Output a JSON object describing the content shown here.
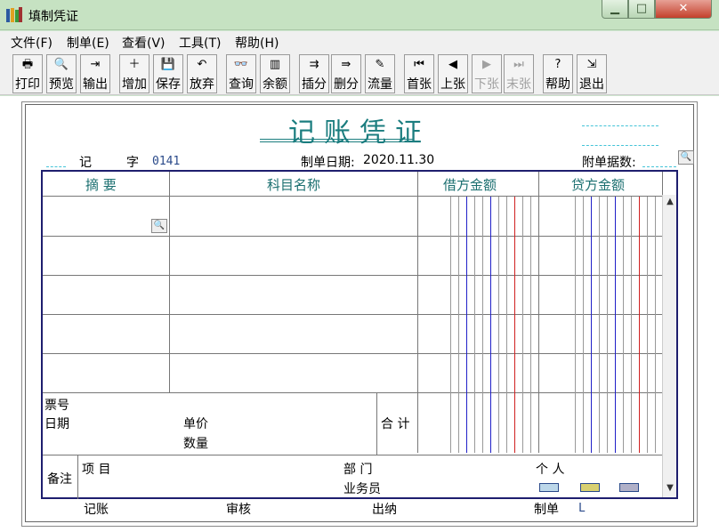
{
  "window": {
    "title": "填制凭证",
    "controls": [
      "minimize",
      "maximize",
      "close"
    ]
  },
  "menu": [
    "文件(F)",
    "制单(E)",
    "查看(V)",
    "工具(T)",
    "帮助(H)"
  ],
  "toolbar": [
    {
      "label": "打印",
      "icon": "printer-icon",
      "glyph": "🖶",
      "enabled": true
    },
    {
      "label": "预览",
      "icon": "preview-icon",
      "glyph": "🔍",
      "enabled": true
    },
    {
      "label": "输出",
      "icon": "export-icon",
      "glyph": "⇥",
      "enabled": true
    },
    {
      "label": "增加",
      "icon": "add-icon",
      "glyph": "＋",
      "enabled": true
    },
    {
      "label": "保存",
      "icon": "save-icon",
      "glyph": "💾",
      "enabled": true
    },
    {
      "label": "放弃",
      "icon": "undo-icon",
      "glyph": "↶",
      "enabled": true
    },
    {
      "label": "查询",
      "icon": "binoculars-icon",
      "glyph": "👓",
      "enabled": true
    },
    {
      "label": "余额",
      "icon": "bar-chart-icon",
      "glyph": "▥",
      "enabled": true
    },
    {
      "label": "插分",
      "icon": "insert-row-icon",
      "glyph": "⇉",
      "enabled": true
    },
    {
      "label": "删分",
      "icon": "delete-row-icon",
      "glyph": "⇛",
      "enabled": true
    },
    {
      "label": "流量",
      "icon": "edit-flow-icon",
      "glyph": "✎",
      "enabled": true
    },
    {
      "label": "首张",
      "icon": "first-record-icon",
      "glyph": "⏮",
      "enabled": true
    },
    {
      "label": "上张",
      "icon": "previous-record-icon",
      "glyph": "◀",
      "enabled": true
    },
    {
      "label": "下张",
      "icon": "next-record-icon",
      "glyph": "▶",
      "enabled": false
    },
    {
      "label": "末张",
      "icon": "last-record-icon",
      "glyph": "⏭",
      "enabled": false
    },
    {
      "label": "帮助",
      "icon": "help-icon",
      "glyph": "?",
      "enabled": true
    },
    {
      "label": "退出",
      "icon": "exit-icon",
      "glyph": "⇲",
      "enabled": true
    }
  ],
  "voucher": {
    "title": "记账凭证",
    "type_label": "记",
    "number_label": "字",
    "number": "0141",
    "date_label": "制单日期:",
    "date": "2020.11.30",
    "attachments_label": "附单据数:",
    "attachments": ""
  },
  "table": {
    "columns": [
      "摘 要",
      "科目名称",
      "借方金额",
      "贷方金额"
    ],
    "rows": [
      {
        "summary": "",
        "account": "",
        "debit": "",
        "credit": ""
      },
      {
        "summary": "",
        "account": "",
        "debit": "",
        "credit": ""
      },
      {
        "summary": "",
        "account": "",
        "debit": "",
        "credit": ""
      },
      {
        "summary": "",
        "account": "",
        "debit": "",
        "credit": ""
      },
      {
        "summary": "",
        "account": "",
        "debit": "",
        "credit": ""
      }
    ]
  },
  "footer": {
    "ticket_no_label": "票号",
    "date_label": "日期",
    "unit_price_label": "单价",
    "quantity_label": "数量",
    "total_label": "合 计",
    "remarks_label": "备注",
    "project_label": "项 目",
    "department_label": "部 门",
    "person_label": "个 人",
    "salesperson_label": "业务员"
  },
  "signatures": {
    "bookkeeper_label": "记账",
    "reviewer_label": "审核",
    "cashier_label": "出纳",
    "preparer_label": "制单",
    "preparer": "L"
  },
  "colors": {
    "title": "#1b7d7f",
    "grid_border": "#1e1e6e",
    "amount_line_blue": "#2020c8",
    "amount_line_red": "#d02020",
    "amount_line_gray": "#999999"
  }
}
